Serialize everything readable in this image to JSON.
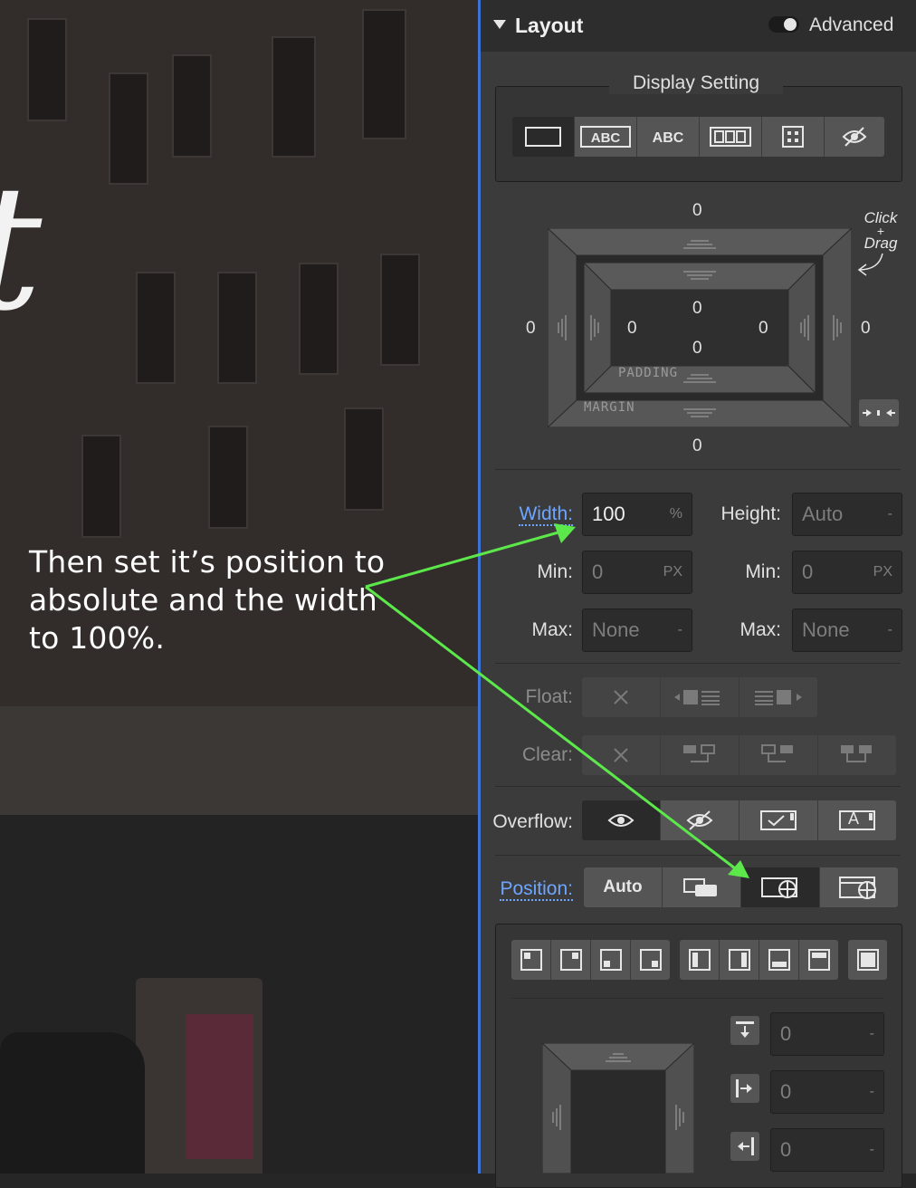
{
  "canvas": {
    "big_letter": "t",
    "caption": "Then set it’s position to absolute and the width to 100%."
  },
  "layout": {
    "section_title": "Layout",
    "advanced_label": "Advanced",
    "display_setting_title": "Display Setting",
    "display_options": [
      "block-icon",
      "inline-block-icon",
      "inline-icon",
      "flex-icon",
      "grid-icon",
      "hidden-icon"
    ],
    "click_drag_hint": "Click + Drag",
    "spacing": {
      "margin_top": "0",
      "margin_right": "0",
      "margin_bottom": "0",
      "margin_left": "0",
      "padding_top": "0",
      "padding_right": "0",
      "padding_bottom": "0",
      "padding_left": "0",
      "padding_label": "PADDING",
      "margin_label": "MARGIN"
    },
    "width": {
      "label": "Width:",
      "value": "100",
      "unit": "%"
    },
    "height": {
      "label": "Height:",
      "value": "Auto",
      "unit": "-"
    },
    "min_width": {
      "label": "Min:",
      "value": "0",
      "unit": "PX"
    },
    "min_height": {
      "label": "Min:",
      "value": "0",
      "unit": "PX"
    },
    "max_width": {
      "label": "Max:",
      "value": "None",
      "unit": "-"
    },
    "max_height": {
      "label": "Max:",
      "value": "None",
      "unit": "-"
    },
    "float_label": "Float:",
    "clear_label": "Clear:",
    "overflow_label": "Overflow:",
    "overflow_scroll_label": "A",
    "position_label": "Position:",
    "position_auto": "Auto",
    "offsets": {
      "top": "0",
      "left": "0",
      "right": "0",
      "unit": "-"
    }
  },
  "colors": {
    "panel": "#3b3b3b",
    "accent_link": "#6ea6ff",
    "annotation_arrow": "#5ce84a",
    "divider": "#3d73d6"
  }
}
